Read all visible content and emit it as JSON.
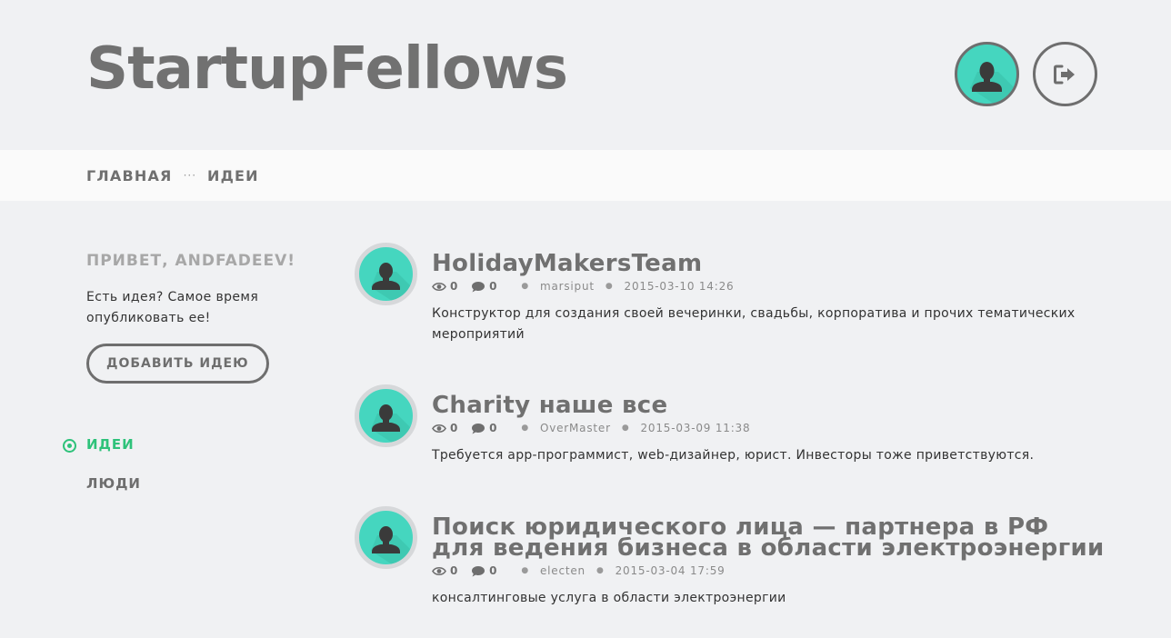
{
  "header": {
    "logo": "StartupFellows"
  },
  "breadcrumbs": {
    "home": "ГЛАВНАЯ",
    "separator": "···",
    "current": "ИДЕИ"
  },
  "sidebar": {
    "greeting": "ПРИВЕТ, ANDFADEEV!",
    "prompt": "Есть идея? Самое время опубликовать ее!",
    "add_button": "ДОБАВИТЬ ИДЕЮ",
    "nav": [
      {
        "label": "ИДЕИ",
        "active": true
      },
      {
        "label": "ЛЮДИ",
        "active": false
      }
    ]
  },
  "ideas": [
    {
      "title": "HolidayMakersTeam",
      "views": "0",
      "comments": "0",
      "author": "marsiput",
      "date": "2015-03-10 14:26",
      "description": "Конструктор для создания своей вечеринки, свадьбы, корпоратива и прочих тематических мероприятий"
    },
    {
      "title": "Charity наше все",
      "views": "0",
      "comments": "0",
      "author": "OverMaster",
      "date": "2015-03-09 11:38",
      "description": "Требуется app-программист, web-дизайнер, юрист. Инвесторы тоже приветствуются."
    },
    {
      "title": "Поиск юридического лица — партнера в РФ для ведения бизнеса в области электроэнергии",
      "views": "0",
      "comments": "0",
      "author": "electen",
      "date": "2015-03-04 17:59",
      "description": "консалтинговые услуга в области электроэнергии"
    }
  ],
  "colors": {
    "background": "#f0f1f3",
    "accent": "#2ec27a",
    "avatar": "#45d6bf",
    "text": "#6e6e6e"
  },
  "icons": {
    "avatar": "user-silhouette-icon",
    "logout": "logout-icon",
    "views": "eye-icon",
    "comments": "comment-icon"
  }
}
